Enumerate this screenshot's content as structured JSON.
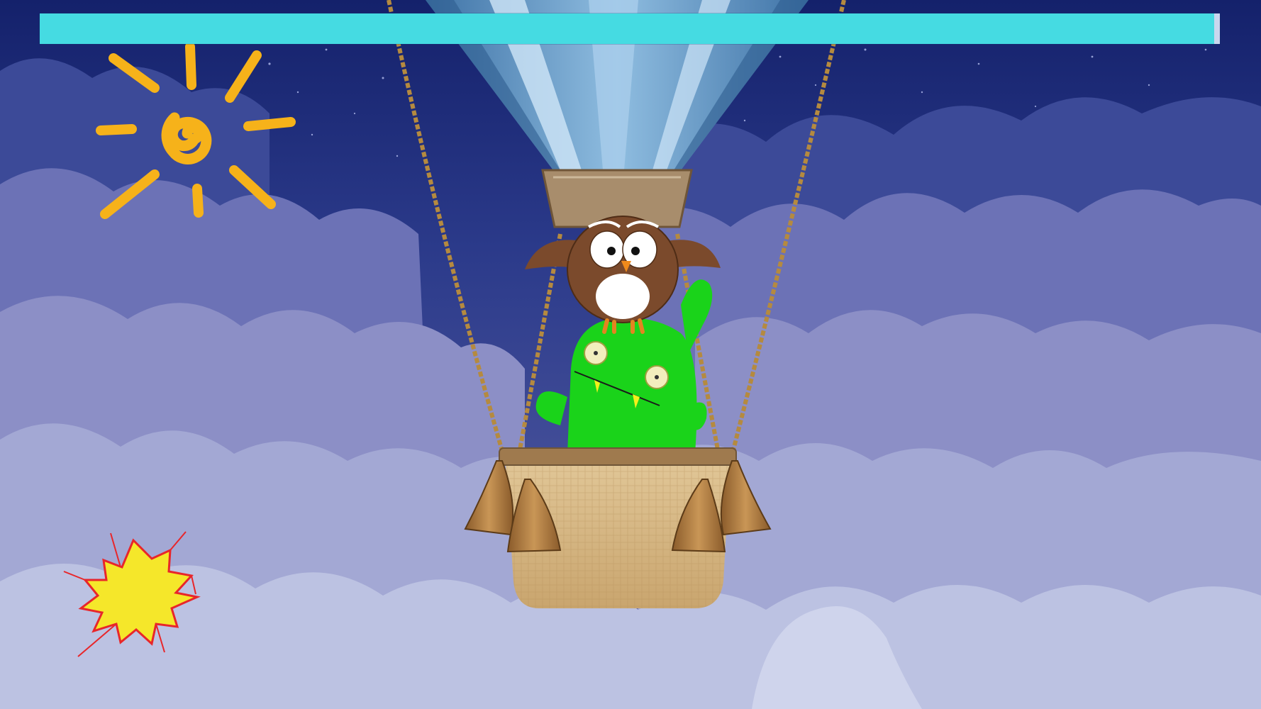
{
  "game": {
    "progress": 0.995,
    "progress_color": "#45dbe2"
  },
  "scene": {
    "sky_top_color": "#14216b",
    "cloud_colors": [
      "#2f3f8c",
      "#6a6fb5",
      "#8f93c9",
      "#a8aed6",
      "#c2c8e4"
    ],
    "sun_color": "#f6b21a",
    "burst_fill": "#f5e72a",
    "burst_stroke": "#e8262a",
    "balloon_colors": [
      "#4f86b8",
      "#9ec6e6",
      "#d7ebf8"
    ],
    "basket_color": "#d8b98a",
    "monster_color": "#1ad31a",
    "owl_color": "#7b4a2c"
  },
  "icons": [
    "sun-icon",
    "burst-icon",
    "hot-air-balloon-icon",
    "owl-character",
    "green-monster-character"
  ]
}
